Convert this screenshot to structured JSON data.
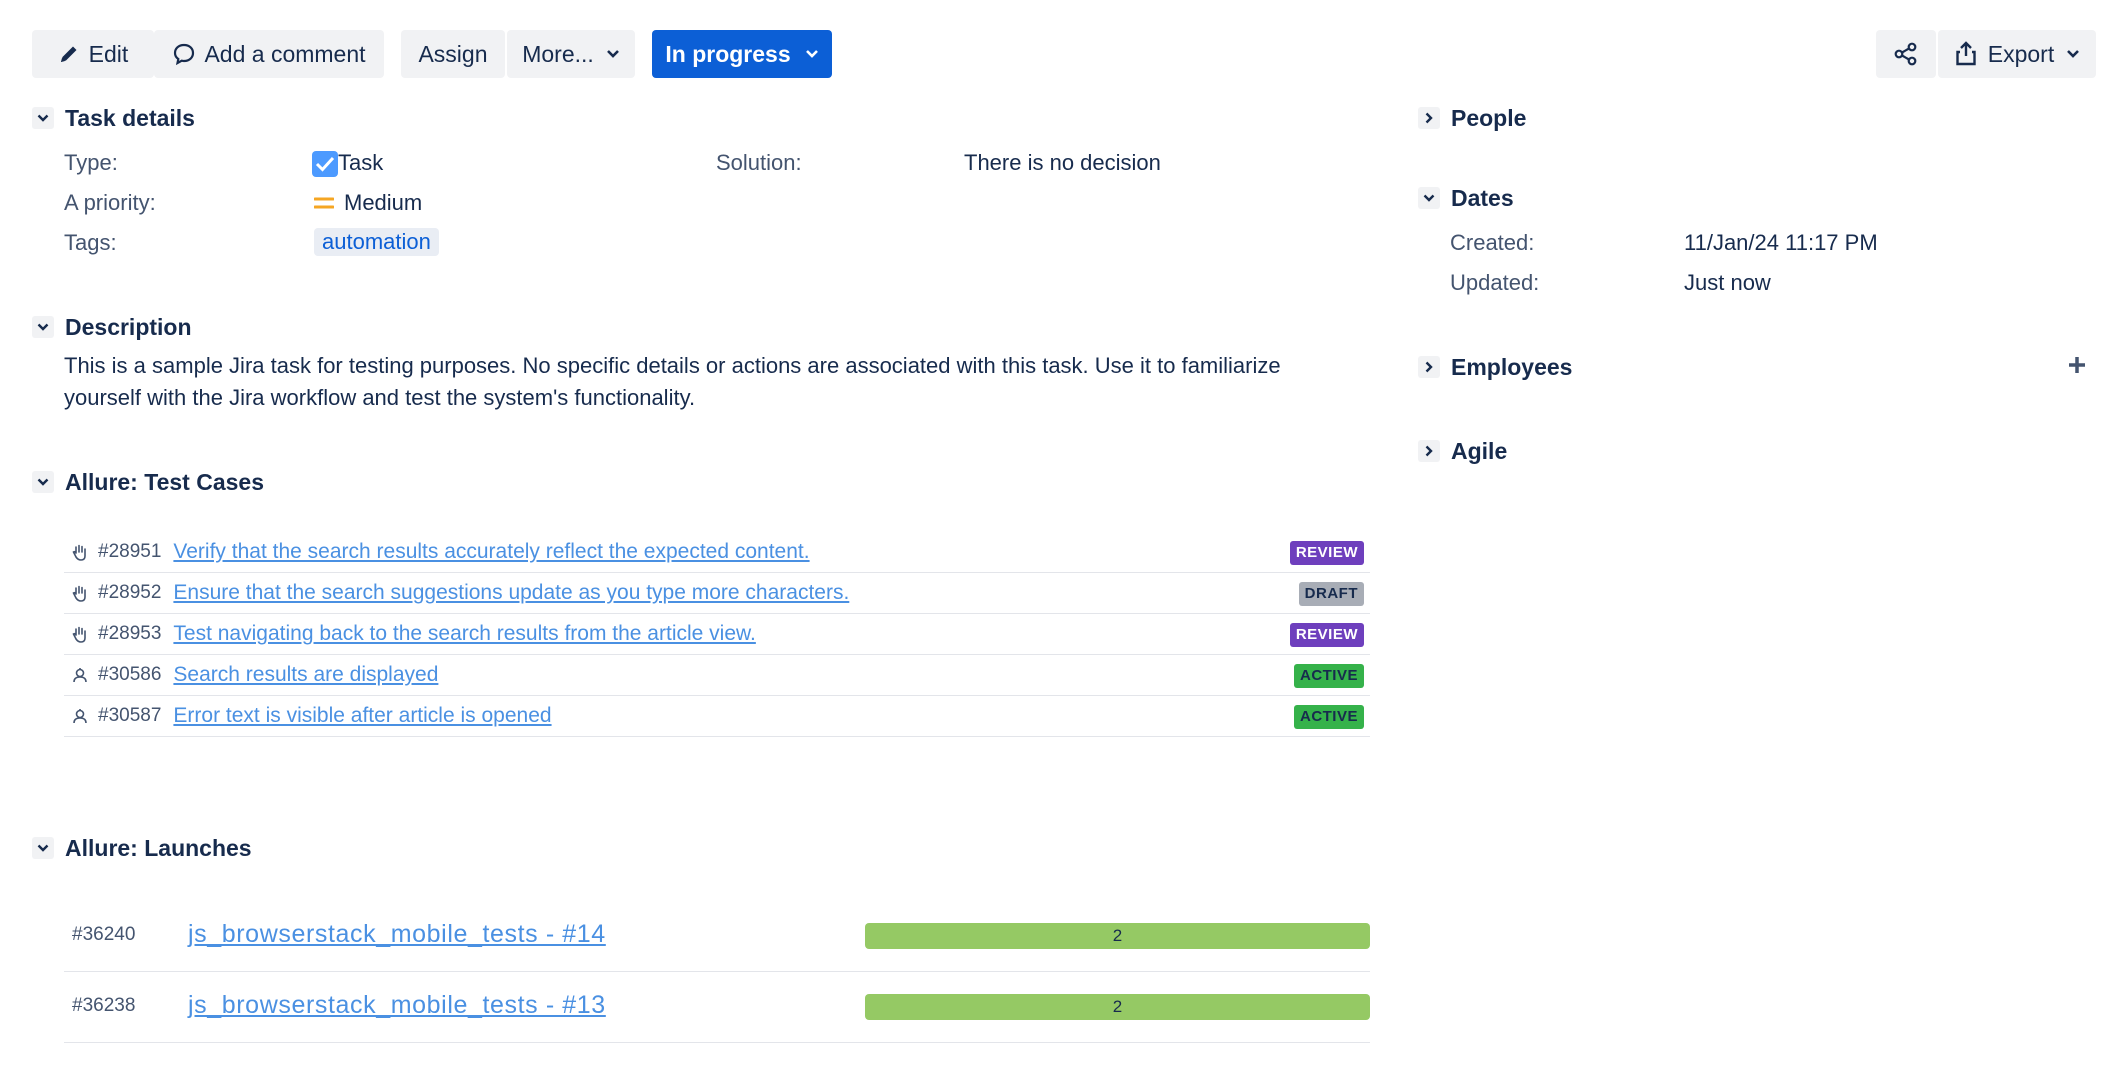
{
  "toolbar": {
    "edit_label": "Edit",
    "comment_label": "Add a comment",
    "assign_label": "Assign",
    "more_label": "More...",
    "status_label": "In progress",
    "export_label": "Export"
  },
  "task_details": {
    "title": "Task details",
    "type_label": "Type:",
    "type_value": "Task",
    "priority_label": "A priority:",
    "priority_value": "Medium",
    "tags_label": "Tags:",
    "tag_value": "automation",
    "solution_label": "Solution:",
    "solution_value": "There is no decision"
  },
  "description": {
    "title": "Description",
    "text": "This is a sample Jira task for testing purposes. No specific details or actions are associated with this task. Use it to familiarize yourself with the Jira workflow and test the system's functionality."
  },
  "test_cases": {
    "title": "Allure: Test Cases",
    "rows": [
      {
        "id": "#28951",
        "title": "Verify that the search results accurately reflect the expected content.",
        "status": "REVIEW",
        "icon": "hand-icon"
      },
      {
        "id": "#28952",
        "title": "Ensure that the search suggestions update as you type more characters.",
        "status": "DRAFT",
        "icon": "hand-icon"
      },
      {
        "id": "#28953",
        "title": "Test navigating back to the search results from the article view.",
        "status": "REVIEW",
        "icon": "hand-icon"
      },
      {
        "id": "#30586",
        "title": "Search results are displayed",
        "status": "ACTIVE",
        "icon": "robot-icon"
      },
      {
        "id": "#30587",
        "title": "Error text is visible after article is opened",
        "status": "ACTIVE",
        "icon": "robot-icon"
      }
    ]
  },
  "launches": {
    "title": "Allure: Launches",
    "rows": [
      {
        "id": "#36240",
        "name": "js_browserstack_mobile_tests - #14",
        "count": "2"
      },
      {
        "id": "#36238",
        "name": "js_browserstack_mobile_tests - #13",
        "count": "2"
      }
    ]
  },
  "sidebar": {
    "people_title": "People",
    "dates_title": "Dates",
    "created_label": "Created:",
    "created_value": "11/Jan/24 11:17 PM",
    "updated_label": "Updated:",
    "updated_value": "Just now",
    "employees_title": "Employees",
    "agile_title": "Agile"
  },
  "colors": {
    "primary": "#0c5fd6",
    "link": "#4a90e2",
    "review": "#6e3fbd",
    "draft": "#a8adb6",
    "active": "#35b24a",
    "launch_bar": "#95c964",
    "priority_medium": "#f5a623"
  }
}
